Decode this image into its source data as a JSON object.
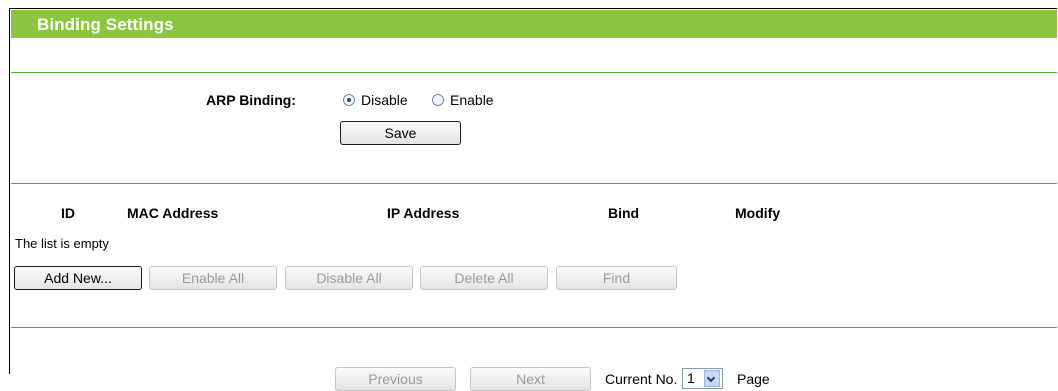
{
  "header": {
    "title": "Binding Settings"
  },
  "arp": {
    "label": "ARP Binding:",
    "options": [
      {
        "label": "Disable",
        "checked": true
      },
      {
        "label": "Enable",
        "checked": false
      }
    ],
    "save_label": "Save"
  },
  "table": {
    "columns": [
      "ID",
      "MAC Address",
      "IP Address",
      "Bind",
      "Modify"
    ],
    "empty_message": "The list is empty"
  },
  "actions": {
    "add_new": "Add New...",
    "enable_all": "Enable All",
    "disable_all": "Disable All",
    "delete_all": "Delete All",
    "find": "Find"
  },
  "pagination": {
    "previous": "Previous",
    "next": "Next",
    "current_label": "Current No.",
    "current_value": "1",
    "page_label": "Page"
  },
  "colors": {
    "header_bg": "#8cc63f",
    "divider": "#4ea83a"
  }
}
